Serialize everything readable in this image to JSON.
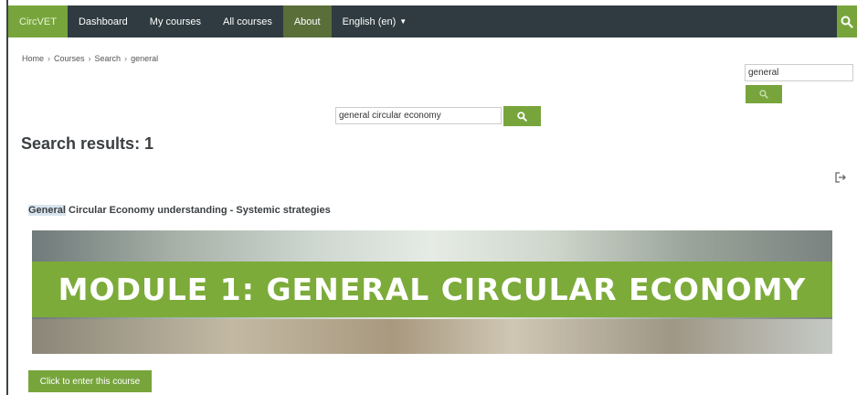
{
  "navbar": {
    "brand": "CircVET",
    "items": [
      "Dashboard",
      "My courses",
      "All courses",
      "About"
    ],
    "language": "English (en)",
    "search_icon": "search-icon"
  },
  "breadcrumb": [
    "Home",
    "Courses",
    "Search",
    "general"
  ],
  "side_search": {
    "value": "general",
    "icon": "search-icon"
  },
  "main_search": {
    "value": "general circular economy",
    "icon": "search-icon"
  },
  "results": {
    "title": "Search results: 1"
  },
  "course": {
    "title_highlight": "General",
    "title_rest": " Circular Economy understanding - Systemic strategies",
    "banner_text": "MODULE 1: GENERAL CIRCULAR ECONOMY",
    "enter_label": "Click to enter this course"
  },
  "colors": {
    "accent": "#77a53c",
    "navbar": "#2f3b40"
  }
}
